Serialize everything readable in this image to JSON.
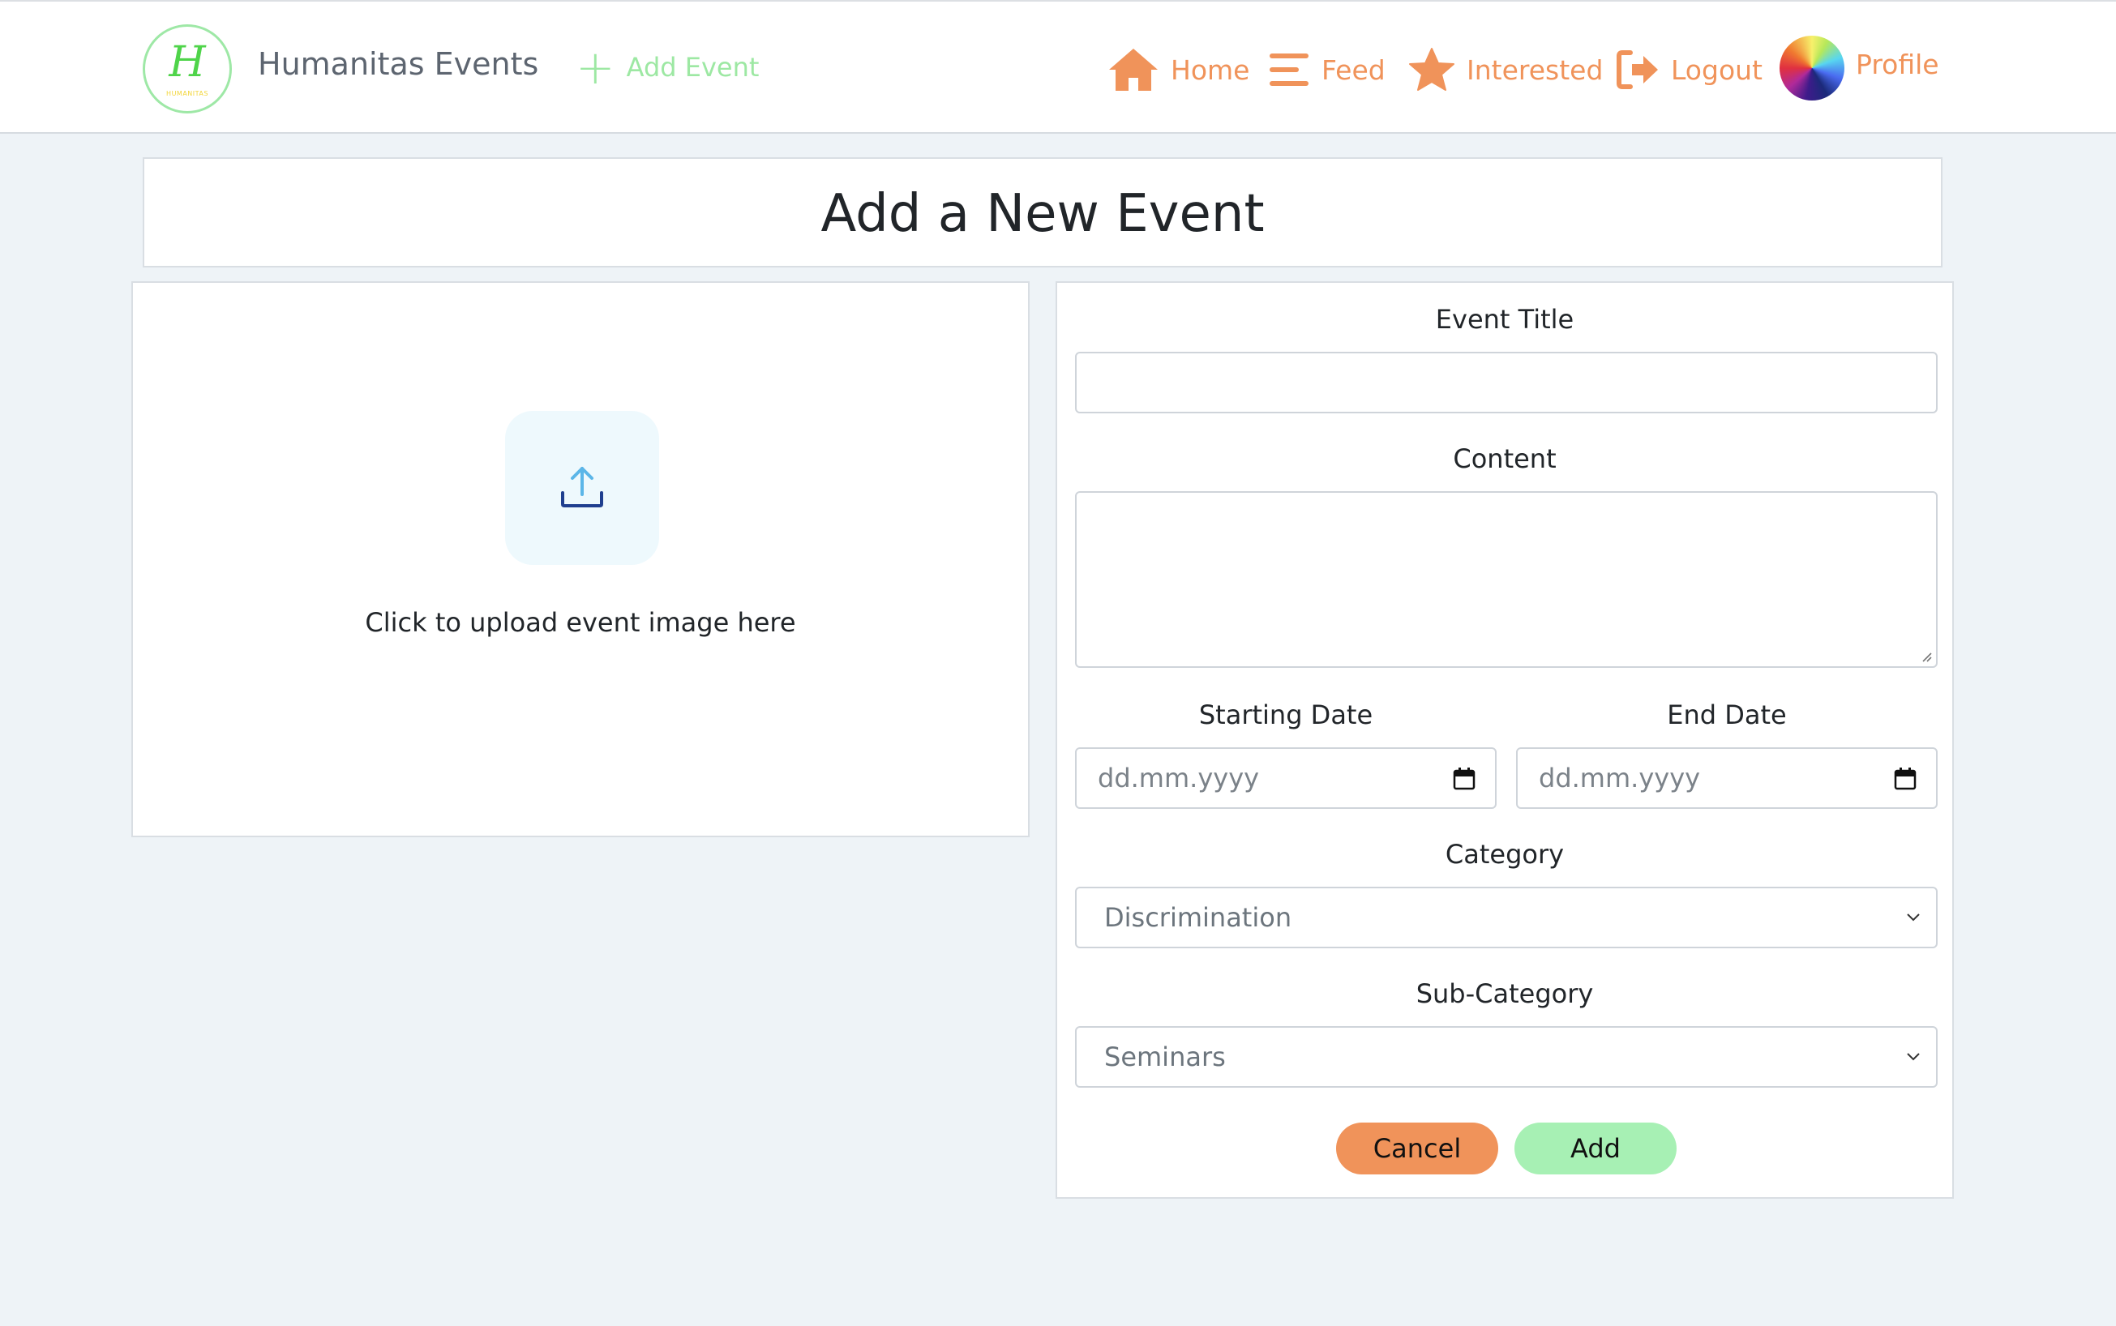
{
  "header": {
    "brand": "Humanitas Events",
    "logo_letter": "H",
    "logo_small_text": "HUMANITAS",
    "add_event": "Add Event",
    "nav": {
      "home": "Home",
      "feed": "Feed",
      "interested": "Interested",
      "logout": "Logout",
      "profile": "Profile"
    }
  },
  "page": {
    "title": "Add a New Event"
  },
  "upload": {
    "text": "Click to upload event image here"
  },
  "form": {
    "event_title_label": "Event Title",
    "event_title_value": "",
    "content_label": "Content",
    "content_value": "",
    "start_date_label": "Starting Date",
    "start_date_placeholder": "dd.mm.yyyy",
    "end_date_label": "End Date",
    "end_date_placeholder": "dd.mm.yyyy",
    "category_label": "Category",
    "category_value": "Discrimination",
    "subcategory_label": "Sub-Category",
    "subcategory_value": "Seminars",
    "cancel_label": "Cancel",
    "add_label": "Add"
  },
  "colors": {
    "accent_orange": "#f0935a",
    "accent_green": "#a7f0b4",
    "background": "#eef3f7"
  },
  "icons": {
    "home": "home-icon",
    "feed": "menu-icon",
    "interested": "star-icon",
    "logout": "logout-icon",
    "upload": "upload-icon",
    "calendar": "calendar-icon"
  }
}
